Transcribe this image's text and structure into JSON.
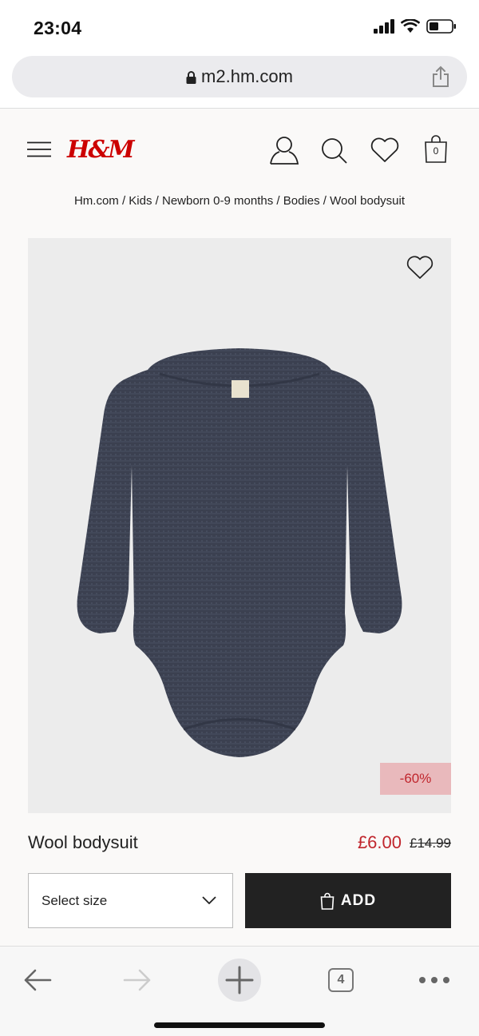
{
  "status": {
    "time": "23:04"
  },
  "browser": {
    "url": "m2.hm.com",
    "tab_count": "4"
  },
  "header": {
    "logo": "H&M",
    "bag_count": "0"
  },
  "breadcrumb": "Hm.com / Kids / Newborn 0-9 months / Bodies / Wool bodysuit",
  "product": {
    "name": "Wool bodysuit",
    "price": "£6.00",
    "old_price": "£14.99",
    "discount": "-60%",
    "size_placeholder": "Select size",
    "add_label": "ADD"
  },
  "colors": {
    "brand": "#cc0000",
    "sale": "#c0262d",
    "garment": "#3a3f4e"
  }
}
